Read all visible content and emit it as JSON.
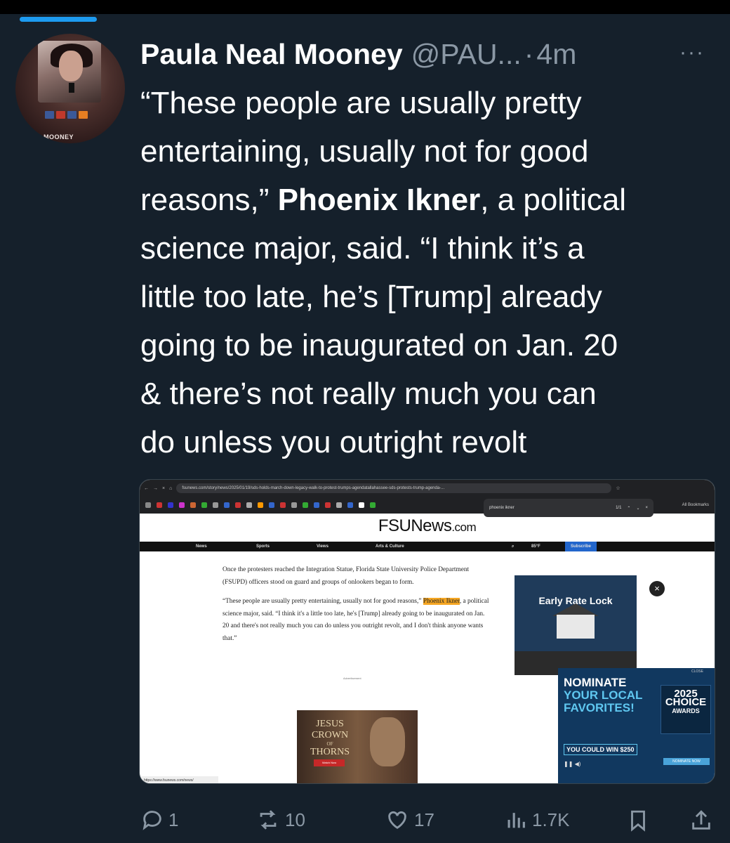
{
  "tweet": {
    "author_name": "Paula Neal Mooney",
    "author_handle": "@PAU...",
    "separator": "·",
    "time": "4m",
    "more_label": "···",
    "avatar_text": "MOONEY",
    "lines": [
      "“These people are usually pretty",
      "entertaining, usually not for good",
      "reasons,”",
      "Phoenix Ikner",
      ", a political",
      "science major, said. “I think it’s a",
      "little too late, he’s [Trump] already",
      "going to be inaugurated on Jan. 20",
      "& there’s not really much you can",
      "do unless you outright revolt"
    ]
  },
  "screenshot": {
    "url": "fsunews.com/story/news/2025/01/19/sds-holds-march-down-legacy-walk-to-protest-trumps-agendatallahassee-sds-protests-trump-agenda-...",
    "find_query": "phoenix ikner",
    "find_count": "1/1",
    "bookmarks_label": "All Bookmarks",
    "site_name": "FSUNews",
    "site_tld": ".com",
    "nav": [
      "News",
      "Sports",
      "Views",
      "Arts & Culture",
      "85°F",
      "Subscribe"
    ],
    "article_p1": "Once the protesters reached the Integration Statue, Florida State University Police Department (FSUPD) officers stood on guard and groups of onlookers began to form.",
    "article_p2_a": "“These people are usually pretty entertaining, usually not for good reasons,” ",
    "article_p2_name": "Phoenix Ikner",
    "article_p2_b": ", a political science major, said. “I think it's a little too late, he's [Trump] already going to be inaugurated on Jan. 20 and there's not really much you can do unless you outright revolt, and I don't think anyone wants that.”",
    "advertisement_label": "Advertisement",
    "ad1_title": "Early Rate Lock",
    "ad2_close": "CLOSE",
    "ad2_line1": "NOMINATE",
    "ad2_line2": "YOUR LOCAL",
    "ad2_line3": "FAVORITES!",
    "ad2_win": "YOU COULD WIN $250",
    "ad2_award_year": "2025",
    "ad2_award_name": "CHOICE",
    "ad2_award_sub": "AWARDS",
    "ad2_nominate_btn": "NOMINATE NOW",
    "ad3_title_1": "JESUS",
    "ad3_title_2": "CROWN",
    "ad3_title_3": "OF",
    "ad3_title_4": "THORNS",
    "ad3_button": "Watch Now",
    "status_url": "https://www.fsunews.com/news/"
  },
  "actions": {
    "replies": "1",
    "reposts": "10",
    "likes": "17",
    "views": "1.7K"
  },
  "colors": {
    "background": "#15202b",
    "accent": "#1d9bf0",
    "muted": "#8b98a5",
    "highlight": "#f5a623"
  },
  "icons": [
    "reply-icon",
    "repost-icon",
    "like-icon",
    "views-icon",
    "bookmark-icon",
    "share-icon"
  ]
}
